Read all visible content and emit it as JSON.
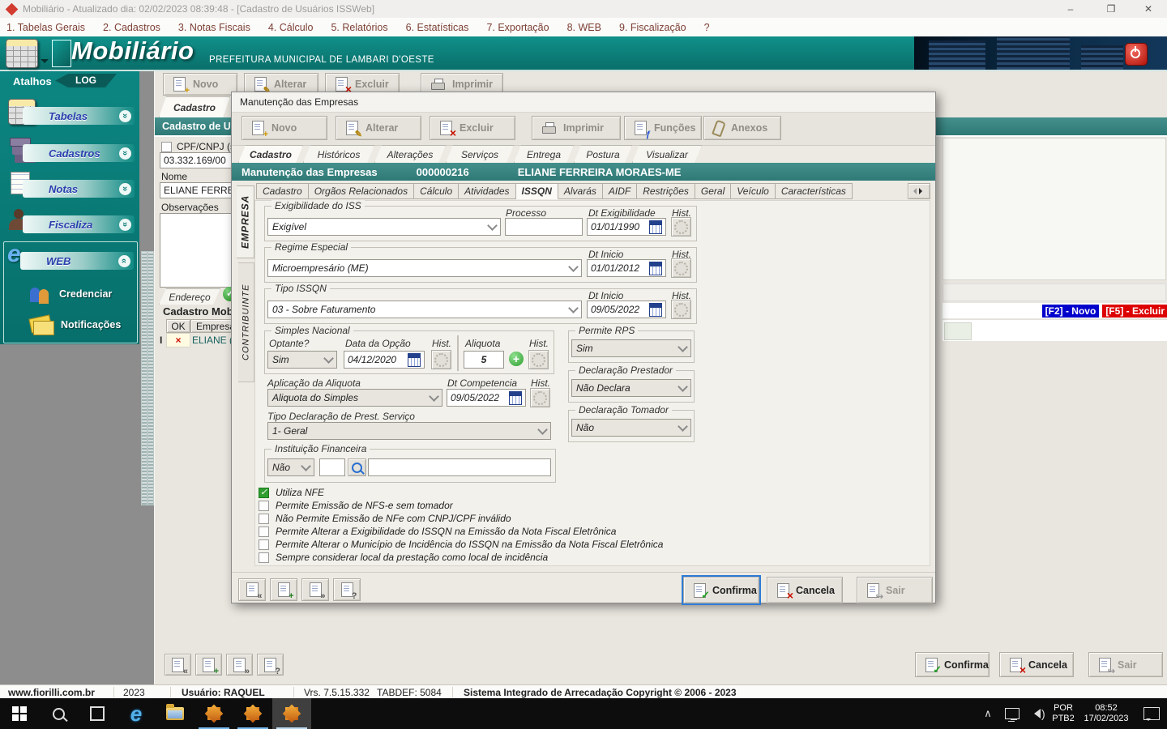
{
  "titlebar": {
    "title": "Mobiliário - Atualizado dia: 02/02/2023 08:39:48 - [Cadastro de Usuários ISSWeb]"
  },
  "menubar": {
    "items": [
      "1. Tabelas Gerais",
      "2. Cadastros",
      "3. Notas Fiscais",
      "4. Cálculo",
      "5. Relatórios",
      "6. Estatísticas",
      "7. Exportação",
      "8. WEB",
      "9. Fiscalização",
      "?"
    ]
  },
  "header": {
    "logo": "Mobiliário",
    "subtitle": "PREFEITURA MUNICIPAL DE LAMBARI D'OESTE"
  },
  "sidebar": {
    "tab_atalhos": "Atalhos",
    "tab_log": "LOG",
    "items": [
      "Tabelas",
      "Cadastros",
      "Notas",
      "Fiscaliza",
      "WEB"
    ],
    "web_children": [
      "Credenciar",
      "Notificações"
    ]
  },
  "main": {
    "toolbar": [
      "Novo",
      "Alterar",
      "Excluir",
      "Imprimir"
    ],
    "tab": "Cadastro",
    "caption": "Cadastro de U",
    "cpf_label": "CPF/CNPJ (s",
    "cpf_value": "03.332.169/00",
    "nome_label": "Nome",
    "nome_value": "ELIANE FERREI",
    "obs_label": "Observações",
    "endereco_tab": "Endereço",
    "grid_caption": "Cadastro Mob",
    "col_ok": "OK",
    "col_empresa": "Empresa",
    "row_cursor": "I",
    "row_x": "×",
    "row_name": "ELIANE (",
    "hint_f2": "[F2] - Novo",
    "hint_f5": "[F5] - Excluir",
    "confirm": "Confirma",
    "cancel": "Cancela",
    "exit": "Sair"
  },
  "dialog": {
    "title": "Manutenção das Empresas",
    "toolbar": [
      "Novo",
      "Alterar",
      "Excluir",
      "Imprimir",
      "Funções",
      "Anexos"
    ],
    "tabs": [
      "Cadastro",
      "Históricos",
      "Alterações",
      "Serviços",
      "Entrega",
      "Postura",
      "Visualizar"
    ],
    "caption": {
      "title": "Manutenção das Empresas",
      "code": "000000216",
      "name": "ELIANE FERREIRA MORAES-ME"
    },
    "side_tabs": [
      "EMPRESA",
      "CONTRIBUINTE"
    ],
    "inner_tabs": [
      "Cadastro",
      "Orgãos Relacionados",
      "Cálculo",
      "Atividades",
      "ISSQN",
      "Alvarás",
      "AIDF",
      "Restrições",
      "Geral",
      "Veículo",
      "Características"
    ],
    "fields": {
      "exigibilidade": {
        "group": "Exigibilidade do ISS",
        "value": "Exigível",
        "processo_label": "Processo",
        "processo_value": "",
        "dt_label": "Dt Exigibilidade",
        "dt_value": "01/01/1990",
        "hist": "Hist."
      },
      "regime": {
        "group": "Regime Especial",
        "value": "Microempresário (ME)",
        "dt_label": "Dt Inicio",
        "dt_value": "01/01/2012",
        "hist": "Hist."
      },
      "tipo_issqn": {
        "group": "Tipo ISSQN",
        "value": "03 - Sobre Faturamento",
        "dt_label": "Dt Inicio",
        "dt_value": "09/05/2022",
        "hist": "Hist."
      },
      "simples": {
        "group": "Simples Nacional",
        "optante_label": "Optante?",
        "optante_value": "Sim",
        "data_label": "Data da Opção",
        "data_value": "04/12/2020",
        "hist1": "Hist.",
        "aliquota_label": "Aliquota",
        "aliquota_value": "5",
        "hist2": "Hist."
      },
      "aplicacao": {
        "label": "Aplicação da Aliquota",
        "value": "Aliquota do Simples",
        "dt_label": "Dt Competencia",
        "dt_value": "09/05/2022",
        "hist": "Hist."
      },
      "tipo_declaracao": {
        "label": "Tipo Declaração de Prest. Serviço",
        "value": "1- Geral"
      },
      "instituicao": {
        "group": "Instituição Financeira",
        "value": "Não",
        "code_value": "",
        "name_value": ""
      },
      "permite_rps": {
        "group": "Permite RPS",
        "value": "Sim"
      },
      "decl_prestador": {
        "group": "Declaração Prestador",
        "value": "Não Declara"
      },
      "decl_tomador": {
        "group": "Declaração Tomador",
        "value": "Não"
      }
    },
    "checkboxes": [
      {
        "label": "Utiliza NFE",
        "checked": true
      },
      {
        "label": "Permite Emissão de NFS-e sem tomador",
        "checked": false
      },
      {
        "label": "Não Permite Emissão de NFe com CNPJ/CPF inválido",
        "checked": false
      },
      {
        "label": "Permite Alterar a Exigibilidade do ISSQN na Emissão da Nota Fiscal Eletrônica",
        "checked": false
      },
      {
        "label": "Permite Alterar o Município de Incidência do ISSQN na Emissão da Nota Fiscal Eletrônica",
        "checked": false
      },
      {
        "label": "Sempre considerar local da prestação como local de incidência",
        "checked": false
      }
    ],
    "confirm": "Confirma",
    "cancel": "Cancela",
    "exit": "Sair"
  },
  "statusbar": {
    "site": "www.fiorilli.com.br",
    "year": "2023",
    "user": "Usuário: RAQUEL",
    "version": "Vrs. 7.5.15.332",
    "tabdef": "TABDEF: 5084",
    "copyright": "Sistema Integrado de Arrecadação Copyright © 2006 - 2023"
  },
  "taskbar": {
    "lang1": "POR",
    "lang2": "PTB2",
    "time": "08:52",
    "date": "17/02/2023"
  },
  "colors": {
    "teal_header": "#0c837e",
    "teal_caption": "#35807d",
    "hint_blue": "#0000cc",
    "hint_red": "#dd0000",
    "menu_text": "#7d4036",
    "taskbar_underline": "#76b9ed"
  }
}
